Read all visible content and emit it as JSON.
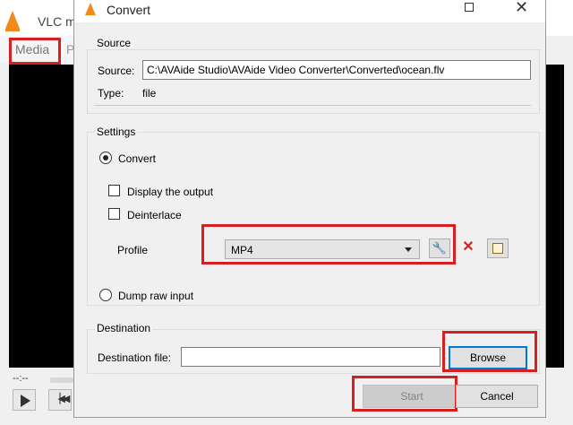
{
  "vlc": {
    "title": "VLC m",
    "menu_media": "Media",
    "menu_p": "P",
    "time": "--:--",
    "play_icon": "play-icon",
    "prev_icon": "previous-icon"
  },
  "dialog": {
    "title": "Convert",
    "source": {
      "group_title": "Source",
      "source_label": "Source:",
      "source_value": "C:\\AVAide Studio\\AVAide Video Converter\\Converted\\ocean.flv",
      "type_label": "Type:",
      "type_value": "file"
    },
    "settings": {
      "group_title": "Settings",
      "convert_label": "Convert",
      "display_output_label": "Display the output",
      "deinterlace_label": "Deinterlace",
      "profile_label": "Profile",
      "profile_value": "MP4",
      "dump_raw_label": "Dump raw input",
      "delete_glyph": "✕"
    },
    "destination": {
      "group_title": "Destination",
      "file_label": "Destination file:",
      "file_value": "",
      "browse_label": "Browse"
    },
    "start_label": "Start",
    "cancel_label": "Cancel"
  },
  "colors": {
    "highlight": "#d6201f",
    "accent": "#0078d7",
    "vlc_orange": "#f08a1b"
  }
}
